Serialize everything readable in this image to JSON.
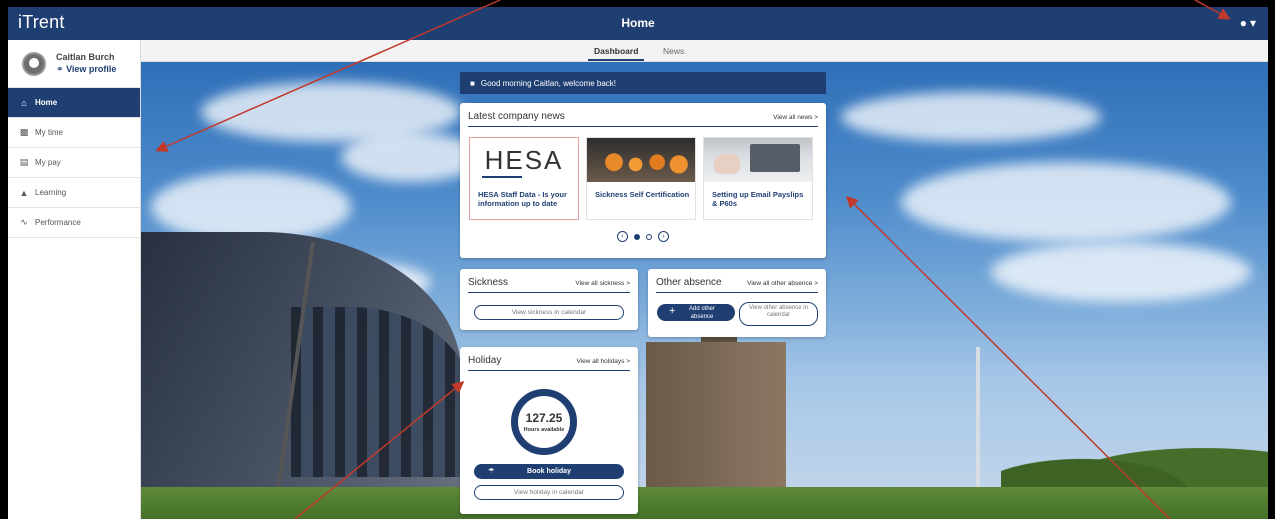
{
  "app": {
    "brand": "iTrent",
    "title": "Home"
  },
  "user": {
    "name": "Caitlan Burch",
    "profile_link": "View profile"
  },
  "sidebar": {
    "items": [
      {
        "label": "Home",
        "icon": "home-icon",
        "active": true
      },
      {
        "label": "My time",
        "icon": "calendar-icon",
        "active": false
      },
      {
        "label": "My pay",
        "icon": "card-icon",
        "active": false
      },
      {
        "label": "Learning",
        "icon": "graduation-cap-icon",
        "active": false
      },
      {
        "label": "Performance",
        "icon": "trend-icon",
        "active": false
      }
    ]
  },
  "tabs": [
    {
      "label": "Dashboard",
      "active": true
    },
    {
      "label": "News",
      "active": false
    }
  ],
  "welcome": "Good morning Caitlan, welcome back!",
  "news": {
    "title": "Latest company news",
    "link": "View all news >",
    "items": [
      {
        "title": "HESA Staff Data - Is your information up to date",
        "image_text": "HESA"
      },
      {
        "title": "Sickness Self Certification"
      },
      {
        "title": "Setting up Email Payslips & P60s"
      }
    ],
    "carousel": {
      "pages": 2,
      "current": 1
    }
  },
  "sickness": {
    "title": "Sickness",
    "link": "View all sickness >",
    "calendar_button": "View sickness in calendar"
  },
  "other_absence": {
    "title": "Other absence",
    "link": "View all other absence >",
    "add_button": "Add other absence",
    "calendar_button": "View other absence in calendar"
  },
  "holiday": {
    "title": "Holiday",
    "link": "View all holidays >",
    "hours": "127.25",
    "hours_label": "Hours available",
    "book_button": "Book holiday",
    "calendar_button": "View holiday in calendar"
  },
  "colors": {
    "primary": "#1f3f73",
    "annotation": "#c0392b"
  }
}
